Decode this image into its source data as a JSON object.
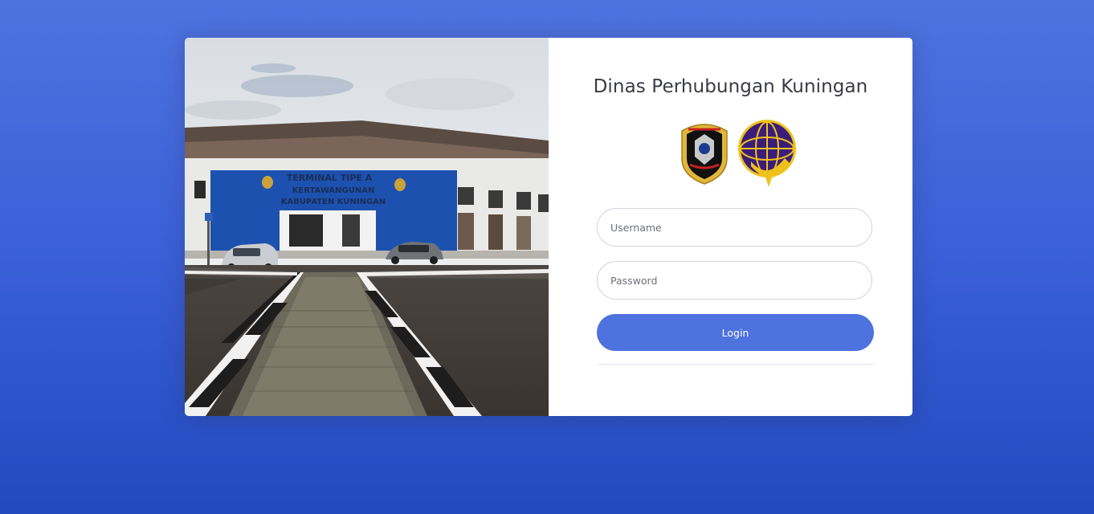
{
  "login": {
    "title": "Dinas Perhubungan Kuningan",
    "username_placeholder": "Username",
    "password_placeholder": "Password",
    "login_label": "Login"
  },
  "photo": {
    "sign_text": "TERMINAL TIPE A KERTAWANGUNAN KABUPATEN KUNINGAN"
  },
  "logos": [
    "district-crest-icon",
    "ditjen-hubdat-emblem-icon"
  ],
  "colors": {
    "accent": "#4e73df",
    "background_top": "#4e73df",
    "background_bottom": "#224abe",
    "card": "#ffffff",
    "title_text": "#3a3b45"
  }
}
